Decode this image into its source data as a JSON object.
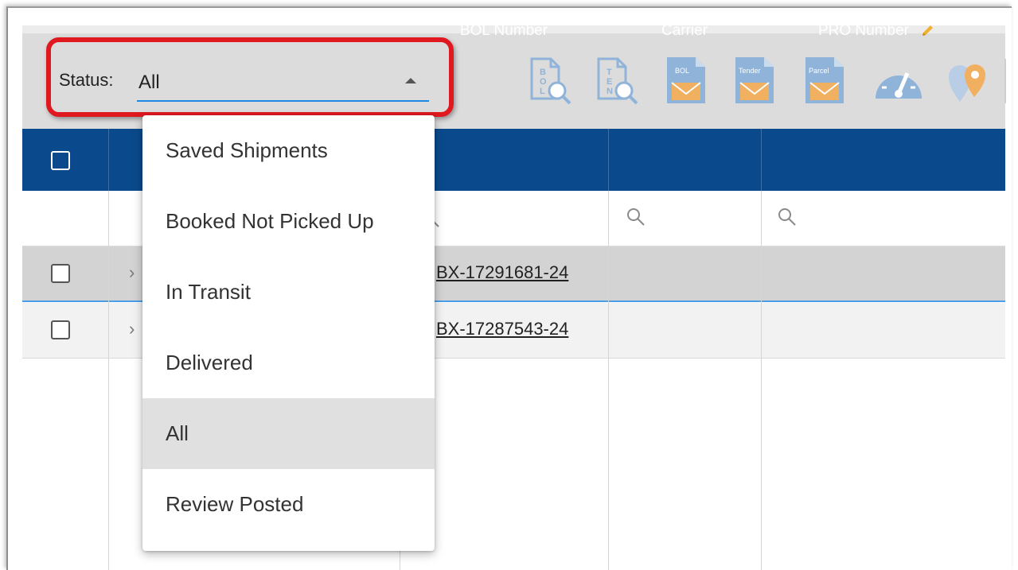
{
  "toolbar": {
    "status_label": "Status:",
    "status_value": "All",
    "icons": [
      {
        "name": "bol-search-icon",
        "letters": "BOL"
      },
      {
        "name": "tender-search-icon",
        "letters": "TEN"
      },
      {
        "name": "bol-email-icon",
        "label": "BOL"
      },
      {
        "name": "tender-email-icon",
        "label": "Tender"
      },
      {
        "name": "parcel-email-icon",
        "label": "Parcel"
      },
      {
        "name": "dashboard-gauge-icon"
      },
      {
        "name": "map-pins-icon"
      }
    ],
    "colors": {
      "icon_blue": "#8fb3d9",
      "icon_envelope": "#f0b060",
      "highlight": "#e0181f"
    }
  },
  "table": {
    "columns": {
      "bol_number": "BOL Number",
      "carrier": "Carrier",
      "pro_number": "PRO Number"
    },
    "rows": [
      {
        "bol": "BX-17291681-24"
      },
      {
        "bol": "BX-17287543-24"
      }
    ],
    "header_color": "#0a4a8c"
  },
  "dropdown": {
    "options": [
      {
        "label": "Saved Shipments"
      },
      {
        "label": "Booked Not Picked Up"
      },
      {
        "label": "In Transit"
      },
      {
        "label": "Delivered"
      },
      {
        "label": "All"
      },
      {
        "label": "Review Posted"
      }
    ],
    "selected": "All"
  }
}
